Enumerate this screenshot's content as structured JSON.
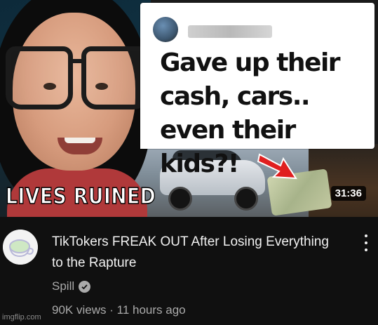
{
  "thumbnail": {
    "headline": "Gave up their cash, cars.. even their kids?!",
    "overlay_caption": "LIVES RUINED",
    "duration": "31:36"
  },
  "video": {
    "title": "TikTokers FREAK OUT After Losing Everything to the Rapture",
    "channel_name": "Spill",
    "channel_verified_icon": "verified-check-icon",
    "views": "90K views",
    "separator": "·",
    "age": "11 hours ago",
    "more_icon": "more-vert-icon"
  },
  "watermark": "imgflip.com",
  "colors": {
    "background": "#0f0f0f",
    "title_text": "#f1f1f1",
    "secondary_text": "#aaaaaa",
    "arrow_red": "#e01f1f"
  }
}
